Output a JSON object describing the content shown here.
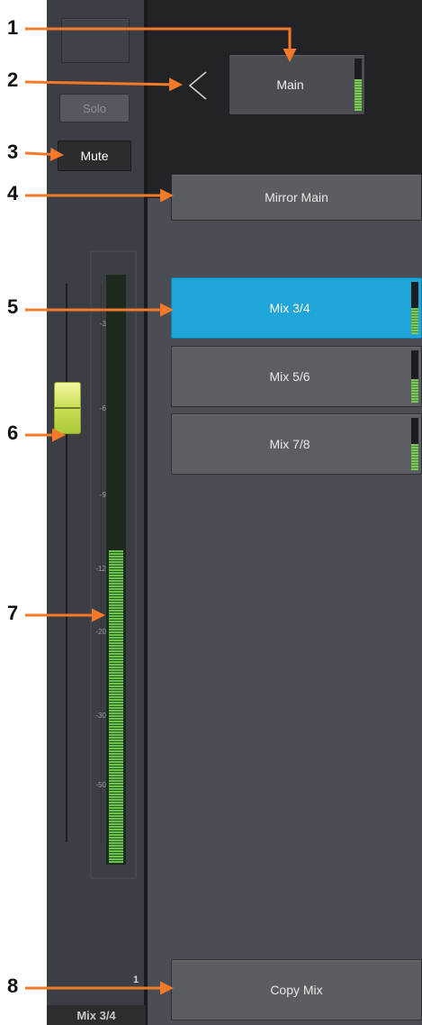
{
  "channel_strip": {
    "solo_label": "Solo",
    "mute_label": "Mute",
    "channel_number": "1",
    "channel_name": "Mix 3/4",
    "meter_scale": [
      "-3",
      "-6",
      "-9",
      "-12",
      "-20",
      "-30",
      "-50"
    ],
    "meter_level_fraction": 0.53,
    "fader_position_db": "-6"
  },
  "header": {
    "main_label": "Main",
    "main_meter_fraction": 0.6
  },
  "mirror_label": "Mirror Main",
  "mix_list": [
    {
      "label": "Mix 3/4",
      "selected": true,
      "meter_fraction": 0.5
    },
    {
      "label": "Mix 5/6",
      "selected": false,
      "meter_fraction": 0.45
    },
    {
      "label": "Mix 7/8",
      "selected": false,
      "meter_fraction": 0.5
    }
  ],
  "copy_label": "Copy Mix",
  "callouts": [
    "1",
    "2",
    "3",
    "4",
    "5",
    "6",
    "7",
    "8"
  ],
  "colors": {
    "accent": "#1fa5d8",
    "callout_arrow": "#f47a2a",
    "meter": "#6ac24b",
    "fader_cap": "#d8e764"
  }
}
